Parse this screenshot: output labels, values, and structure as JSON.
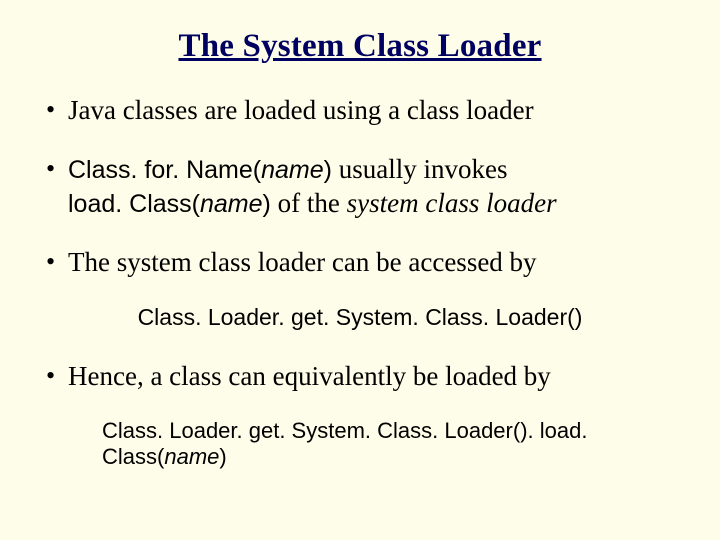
{
  "title": "The System Class Loader",
  "bullets": {
    "b1": "Java classes are loaded using a class loader",
    "b2": {
      "code1a": "Class. for. Name(",
      "code1b": "name",
      "code1c": ")",
      "t1": " usually invokes ",
      "code2a": "load. Class(",
      "code2b": "name",
      "code2c": ")",
      "t2": " of the ",
      "ital": "system class loader"
    },
    "b3": "The system class loader can be accessed by",
    "code3": "Class. Loader. get. System. Class. Loader()",
    "b4": "Hence, a class can equivalently be loaded by",
    "code4a": "Class. Loader. get. System. Class. Loader(). load. Class(",
    "code4b": "name",
    "code4c": ")"
  }
}
